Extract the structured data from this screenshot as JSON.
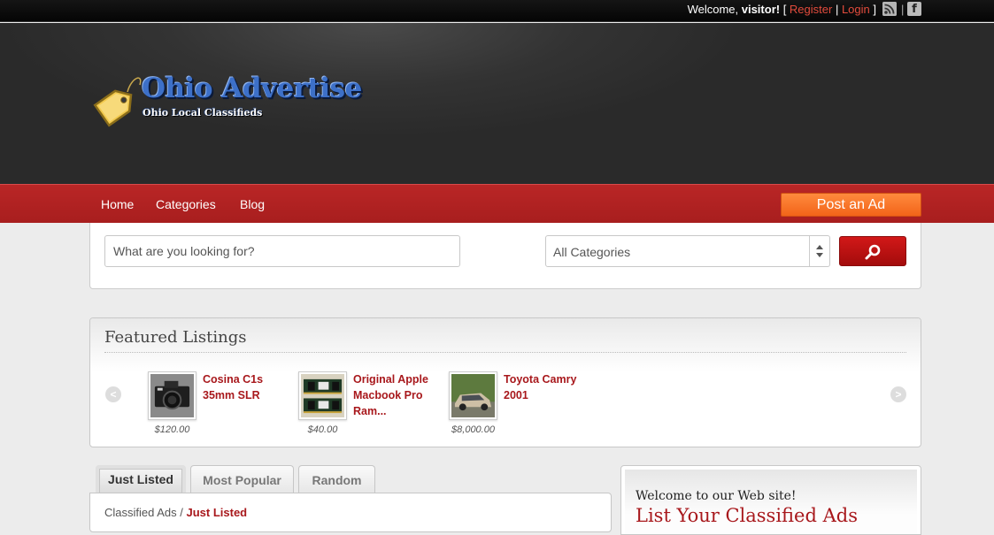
{
  "topbar": {
    "welcome_prefix": "Welcome, ",
    "visitor": "visitor!",
    "bracket_open": " [ ",
    "register": "Register",
    "pipe": " | ",
    "login": "Login",
    "bracket_close": " ]",
    "separator": "|",
    "facebook_glyph": "f",
    "rss_icon": "rss-icon",
    "facebook_icon": "facebook-icon"
  },
  "header": {
    "logo_title": "Ohio Advertise",
    "logo_subtitle": "Ohio Local Classifieds",
    "logo_icon": "price-tag-icon"
  },
  "nav": {
    "items": [
      "Home",
      "Categories",
      "Blog"
    ],
    "post_ad": "Post an Ad"
  },
  "search": {
    "placeholder": "What are you looking for?",
    "category_value": "All Categories",
    "button_icon": "search-icon"
  },
  "featured": {
    "title": "Featured Listings",
    "prev_glyph": "<",
    "next_glyph": ">",
    "items": [
      {
        "title": "Cosina C1s 35mm SLR",
        "price": "$120.00"
      },
      {
        "title": "Original Apple Macbook Pro Ram...",
        "price": "$40.00"
      },
      {
        "title": "Toyota Camry 2001",
        "price": "$8,000.00"
      }
    ]
  },
  "tabs": {
    "items": [
      "Just Listed",
      "Most Popular",
      "Random"
    ],
    "active": "Just Listed"
  },
  "breadcrumb": {
    "root": "Classified Ads",
    "sep": " / ",
    "current": "Just Listed"
  },
  "welcome_box": {
    "title": "Welcome to our Web site!",
    "headline": "List Your Classified Ads"
  },
  "colors": {
    "nav_red": "#b02222",
    "post_orange": "#f47a2e",
    "link_red": "#a8181c",
    "logo_blue": "#3d70c8",
    "tag_yellow": "#f2c94c"
  }
}
